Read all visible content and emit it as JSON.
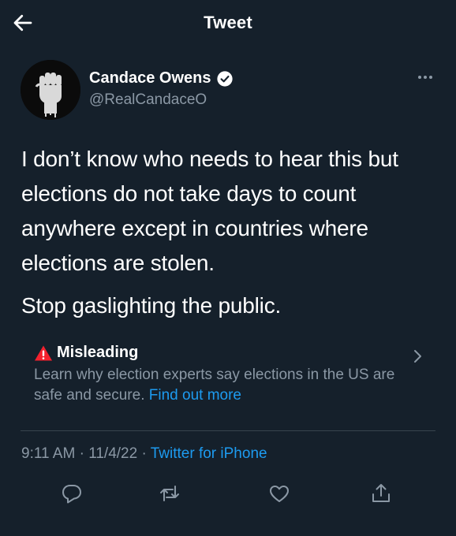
{
  "header": {
    "title": "Tweet"
  },
  "user": {
    "name": "Candace Owens",
    "handle": "@RealCandaceO"
  },
  "tweet": {
    "paragraphs": [
      "I don’t know who needs to hear this but elections do not take days to count anywhere except in countries where elections are stolen.",
      "Stop gaslighting the public."
    ]
  },
  "label": {
    "title": "Misleading",
    "description": "Learn why election experts say elections in the US are safe and secure.",
    "link": "Find out more"
  },
  "meta": {
    "time": "9:11 AM",
    "separator": " · ",
    "date": "11/4/22",
    "source": "Twitter for iPhone"
  },
  "icons": {
    "back": "arrow-left-icon",
    "verified": "verified-badge-icon",
    "more": "more-horizontal-icon",
    "warning": "warning-triangle-icon",
    "chevron": "chevron-right-icon",
    "reply": "reply-icon",
    "retweet": "retweet-icon",
    "like": "heart-icon",
    "share": "share-icon"
  },
  "colors": {
    "background": "#15202b",
    "secondary_text": "#8b98a5",
    "link": "#1d9bf0",
    "warning": "#f4212e"
  }
}
